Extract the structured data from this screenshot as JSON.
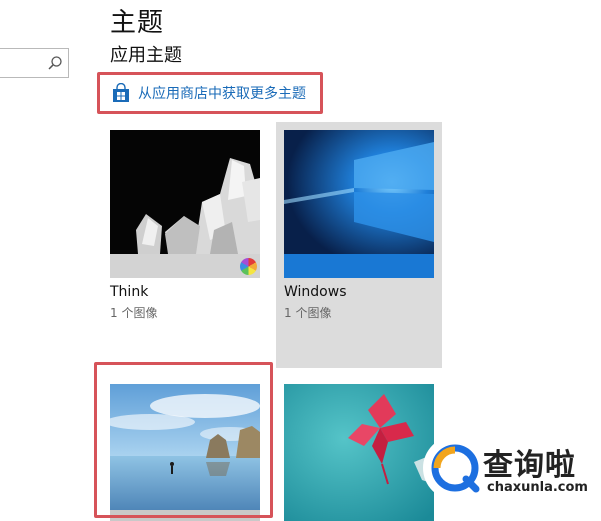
{
  "header": {
    "title": "主题",
    "section_title": "应用主题"
  },
  "search": {
    "placeholder": ""
  },
  "store_link": {
    "label": "从应用商店中获取更多主题",
    "color": "#1a6bb8"
  },
  "themes": [
    {
      "name": "Think",
      "count": "1 个图像",
      "icon": "color-wheel-icon"
    },
    {
      "name": "Windows",
      "count": "1 个图像"
    },
    {
      "name": "",
      "count": ""
    },
    {
      "name": "",
      "count": ""
    }
  ],
  "colors": {
    "highlight_border": "#d65359",
    "selected_tile": "#dcdcdc"
  },
  "watermark": {
    "brand": "查询啦",
    "url": "chaxunla.com"
  }
}
